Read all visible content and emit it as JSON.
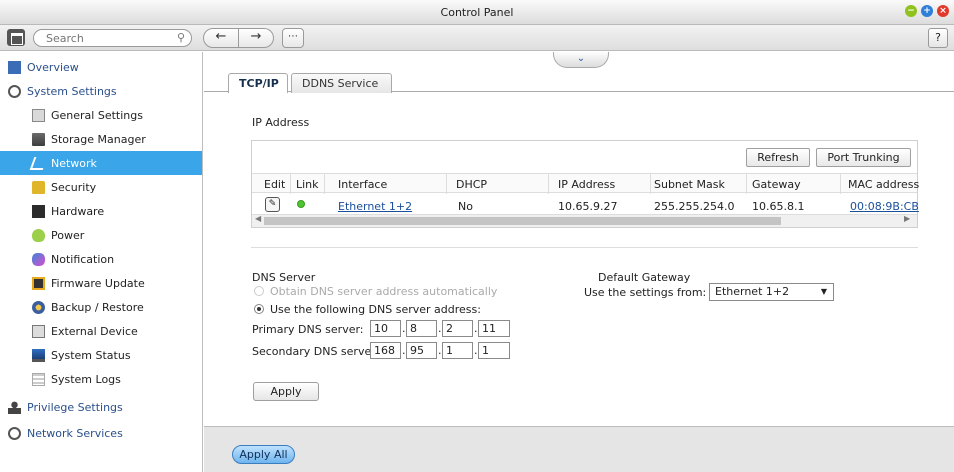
{
  "window": {
    "title": "Control Panel"
  },
  "toolbar": {
    "search_placeholder": "Search",
    "help_label": "?"
  },
  "sidebar": {
    "items": [
      {
        "label": "Overview",
        "level": "top",
        "icon": "overview-icon"
      },
      {
        "label": "System Settings",
        "level": "top",
        "icon": "gear-icon"
      },
      {
        "label": "General Settings",
        "level": "sub",
        "icon": "general-settings-icon"
      },
      {
        "label": "Storage Manager",
        "level": "sub",
        "icon": "storage-icon"
      },
      {
        "label": "Network",
        "level": "sub",
        "icon": "network-icon",
        "active": true
      },
      {
        "label": "Security",
        "level": "sub",
        "icon": "lock-icon"
      },
      {
        "label": "Hardware",
        "level": "sub",
        "icon": "hardware-icon"
      },
      {
        "label": "Power",
        "level": "sub",
        "icon": "power-icon"
      },
      {
        "label": "Notification",
        "level": "sub",
        "icon": "notification-icon"
      },
      {
        "label": "Firmware Update",
        "level": "sub",
        "icon": "firmware-icon"
      },
      {
        "label": "Backup / Restore",
        "level": "sub",
        "icon": "backup-icon"
      },
      {
        "label": "External Device",
        "level": "sub",
        "icon": "external-device-icon"
      },
      {
        "label": "System Status",
        "level": "sub",
        "icon": "monitor-icon"
      },
      {
        "label": "System Logs",
        "level": "sub",
        "icon": "logs-icon"
      },
      {
        "label": "Privilege Settings",
        "level": "top",
        "icon": "user-icon"
      },
      {
        "label": "Network Services",
        "level": "top",
        "icon": "network-services-icon"
      }
    ]
  },
  "tabs": [
    {
      "label": "TCP/IP"
    },
    {
      "label": "DDNS Service"
    }
  ],
  "ip_section": {
    "title": "IP Address",
    "refresh_label": "Refresh",
    "trunk_label": "Port Trunking",
    "columns": [
      "Edit",
      "Link",
      "Interface",
      "DHCP",
      "IP Address",
      "Subnet Mask",
      "Gateway",
      "MAC address"
    ],
    "row": {
      "interface": "Ethernet 1+2",
      "dhcp": "No",
      "ip": "10.65.9.27",
      "subnet": "255.255.254.0",
      "gateway": "10.65.8.1",
      "mac": "00:08:9B:CB"
    }
  },
  "dns": {
    "title": "DNS Server",
    "option_auto": "Obtain DNS server address automatically",
    "option_manual": "Use the following DNS server address:",
    "primary_label": "Primary DNS server:",
    "secondary_label": "Secondary DNS server:",
    "primary": [
      "10",
      "8",
      "2",
      "11"
    ],
    "secondary": [
      "168",
      "95",
      "1",
      "1"
    ],
    "apply_label": "Apply"
  },
  "gateway": {
    "title": "Default Gateway",
    "label": "Use the settings from:",
    "selected": "Ethernet 1+2"
  },
  "footer": {
    "apply_all_label": "Apply All"
  },
  "colors": {
    "accent": "#3aa5e8",
    "nav_text": "#2a4f8a",
    "link_status": "#4ec52f"
  }
}
